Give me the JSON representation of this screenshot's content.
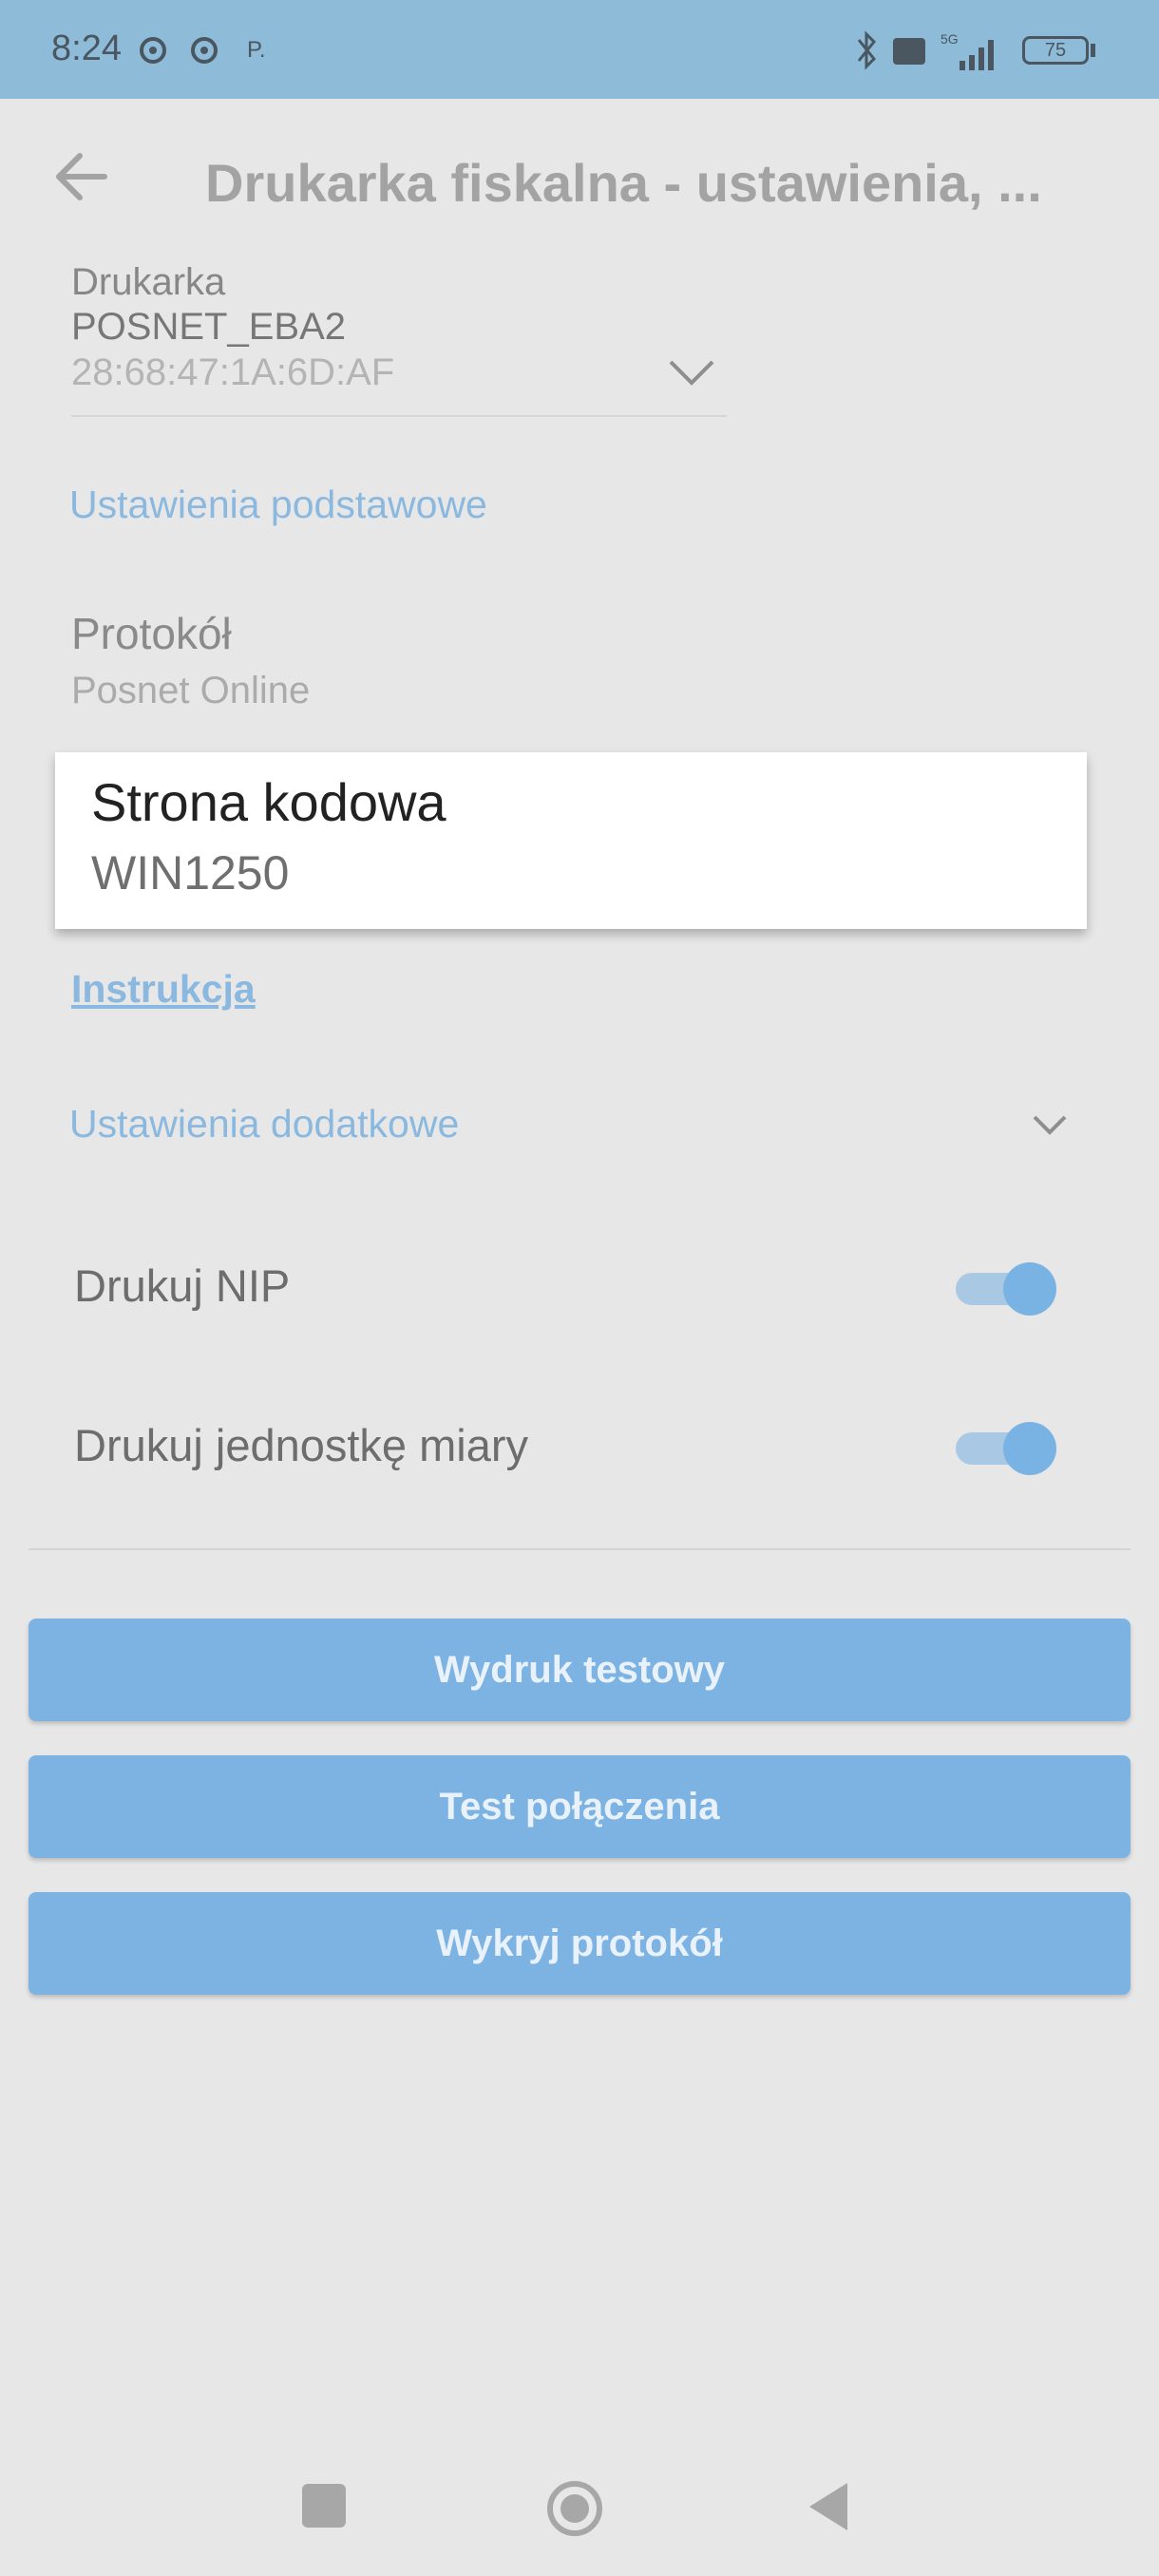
{
  "status_bar": {
    "time": "8:24",
    "battery": "75",
    "network": "5G"
  },
  "app_bar": {
    "title": "Drukarka fiskalna - ustawienia, ..."
  },
  "printer": {
    "label": "Drukarka",
    "name": "POSNET_EBA2",
    "mac": "28:68:47:1A:6D:AF"
  },
  "basic_settings": {
    "header": "Ustawienia podstawowe",
    "protocol_title": "Protokół",
    "protocol_value": "Posnet Online",
    "codepage_title": "Strona kodowa",
    "codepage_value": "WIN1250",
    "instruction_link": "Instrukcja"
  },
  "extra_settings": {
    "header": "Ustawienia dodatkowe",
    "print_nip": {
      "label": "Drukuj NIP",
      "enabled": true
    },
    "print_unit": {
      "label": "Drukuj jednostkę miary",
      "enabled": true
    }
  },
  "buttons": {
    "test_print": "Wydruk testowy",
    "test_connection": "Test połączenia",
    "detect_protocol": "Wykryj protokół"
  },
  "colors": {
    "accent": "#7db3e3",
    "status_bar": "#8dbbd8",
    "background": "#e7e7e7"
  }
}
